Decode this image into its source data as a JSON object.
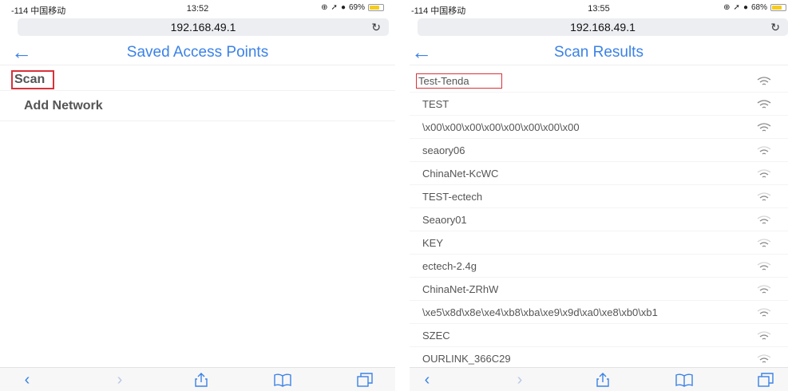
{
  "left": {
    "status": {
      "carrier": "-114 中国移动",
      "time": "13:52",
      "battery": "69%"
    },
    "address": "192.168.49.1",
    "title": "Saved Access Points",
    "menu": [
      {
        "label": "Scan"
      },
      {
        "label": "Add Network"
      }
    ]
  },
  "right": {
    "status": {
      "carrier": "-114 中国移动",
      "time": "13:55",
      "battery": "68%"
    },
    "address": "192.168.49.1",
    "title": "Scan Results",
    "networks": [
      {
        "ssid": "Test-Tenda",
        "signal": 3
      },
      {
        "ssid": "TEST",
        "signal": 3
      },
      {
        "ssid": "\\x00\\x00\\x00\\x00\\x00\\x00\\x00\\x00",
        "signal": 3
      },
      {
        "ssid": "seaory06",
        "signal": 2
      },
      {
        "ssid": "ChinaNet-KcWC",
        "signal": 2
      },
      {
        "ssid": "TEST-ectech",
        "signal": 2
      },
      {
        "ssid": "Seaory01",
        "signal": 2
      },
      {
        "ssid": "KEY",
        "signal": 2
      },
      {
        "ssid": "ectech-2.4g",
        "signal": 2
      },
      {
        "ssid": "ChinaNet-ZRhW",
        "signal": 2
      },
      {
        "ssid": "\\xe5\\x8d\\x8e\\xe4\\xb8\\xba\\xe9\\x9d\\xa0\\xe8\\xb0\\xb1",
        "signal": 2
      },
      {
        "ssid": "SZEC",
        "signal": 2
      },
      {
        "ssid": "OURLINK_366C29",
        "signal": 2
      }
    ]
  },
  "colors": {
    "accent": "#3b82e6",
    "highlight": "#d9323a",
    "battery": "#f5cc1f"
  },
  "toolbar_icons": [
    "back-icon",
    "forward-icon",
    "share-icon",
    "bookmarks-icon",
    "tabs-icon"
  ]
}
